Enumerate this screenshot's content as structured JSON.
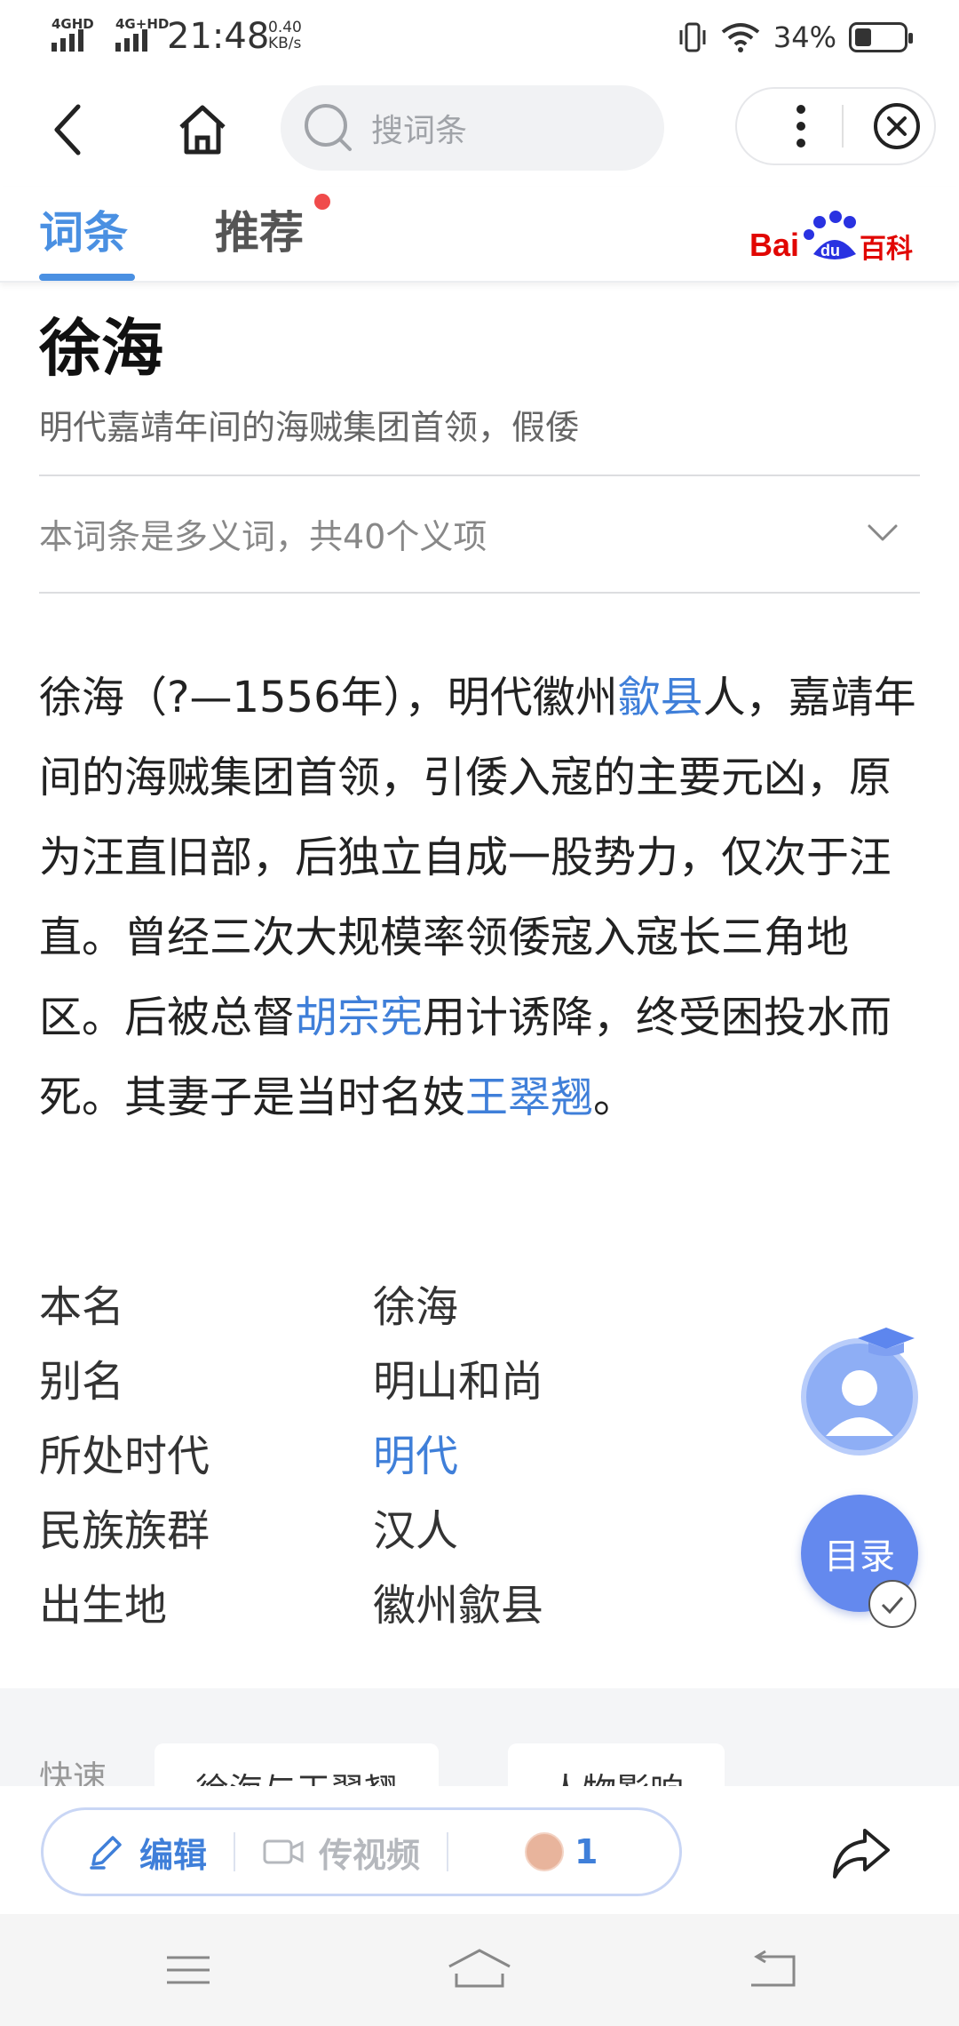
{
  "status_bar": {
    "net1": "4GHD",
    "net2": "4G+HD",
    "time": "21:48",
    "speed_value": "0.40",
    "speed_unit": "KB/s",
    "battery_percent": "34%",
    "battery_level": 0.34
  },
  "nav": {
    "search_placeholder": "搜词条"
  },
  "tabs": {
    "entry": "词条",
    "recommend": "推荐"
  },
  "logo": {
    "text": "Baidu百科"
  },
  "article": {
    "title": "徐海",
    "subtitle": "明代嘉靖年间的海贼集团首领，假倭",
    "polysemy": "本词条是多义词，共40个义项",
    "intro": [
      {
        "text": "徐海（?—1556年），明代徽州",
        "link": false
      },
      {
        "text": "歙县",
        "link": true
      },
      {
        "text": "人，嘉靖年间的海贼集团首领，引倭入寇的主要元凶，原为汪直旧部，后独立自成一股势力，仅次于汪直。曾经三次大规模率领倭寇入寇长三角地区。后被总督",
        "link": false
      },
      {
        "text": "胡宗宪",
        "link": true
      },
      {
        "text": "用计诱降，终受困投水而死。其妻子是当时名妓",
        "link": false
      },
      {
        "text": "王翠翘",
        "link": true
      },
      {
        "text": "。",
        "link": false
      }
    ],
    "infobox": [
      {
        "key": "本名",
        "value": "徐海",
        "link": false
      },
      {
        "key": "别名",
        "value": "明山和尚",
        "link": false
      },
      {
        "key": "所处时代",
        "value": "明代",
        "link": true
      },
      {
        "key": "民族族群",
        "value": "汉人",
        "link": false
      },
      {
        "key": "出生地",
        "value": "徽州歙县",
        "link": false
      }
    ]
  },
  "floating": {
    "toc": "目录"
  },
  "quick": {
    "label": "快速",
    "chips": [
      "徐海与王翠翘",
      "人物影响"
    ]
  },
  "action_bar": {
    "edit": "编辑",
    "video": "传视频",
    "count": "1"
  },
  "colors": {
    "accent": "#4a90e2",
    "link": "#3f7fd9",
    "toc_button": "#6489ee",
    "badge": "#f04b4b",
    "baidu_red": "#e10602",
    "baidu_blue": "#2932e1"
  }
}
